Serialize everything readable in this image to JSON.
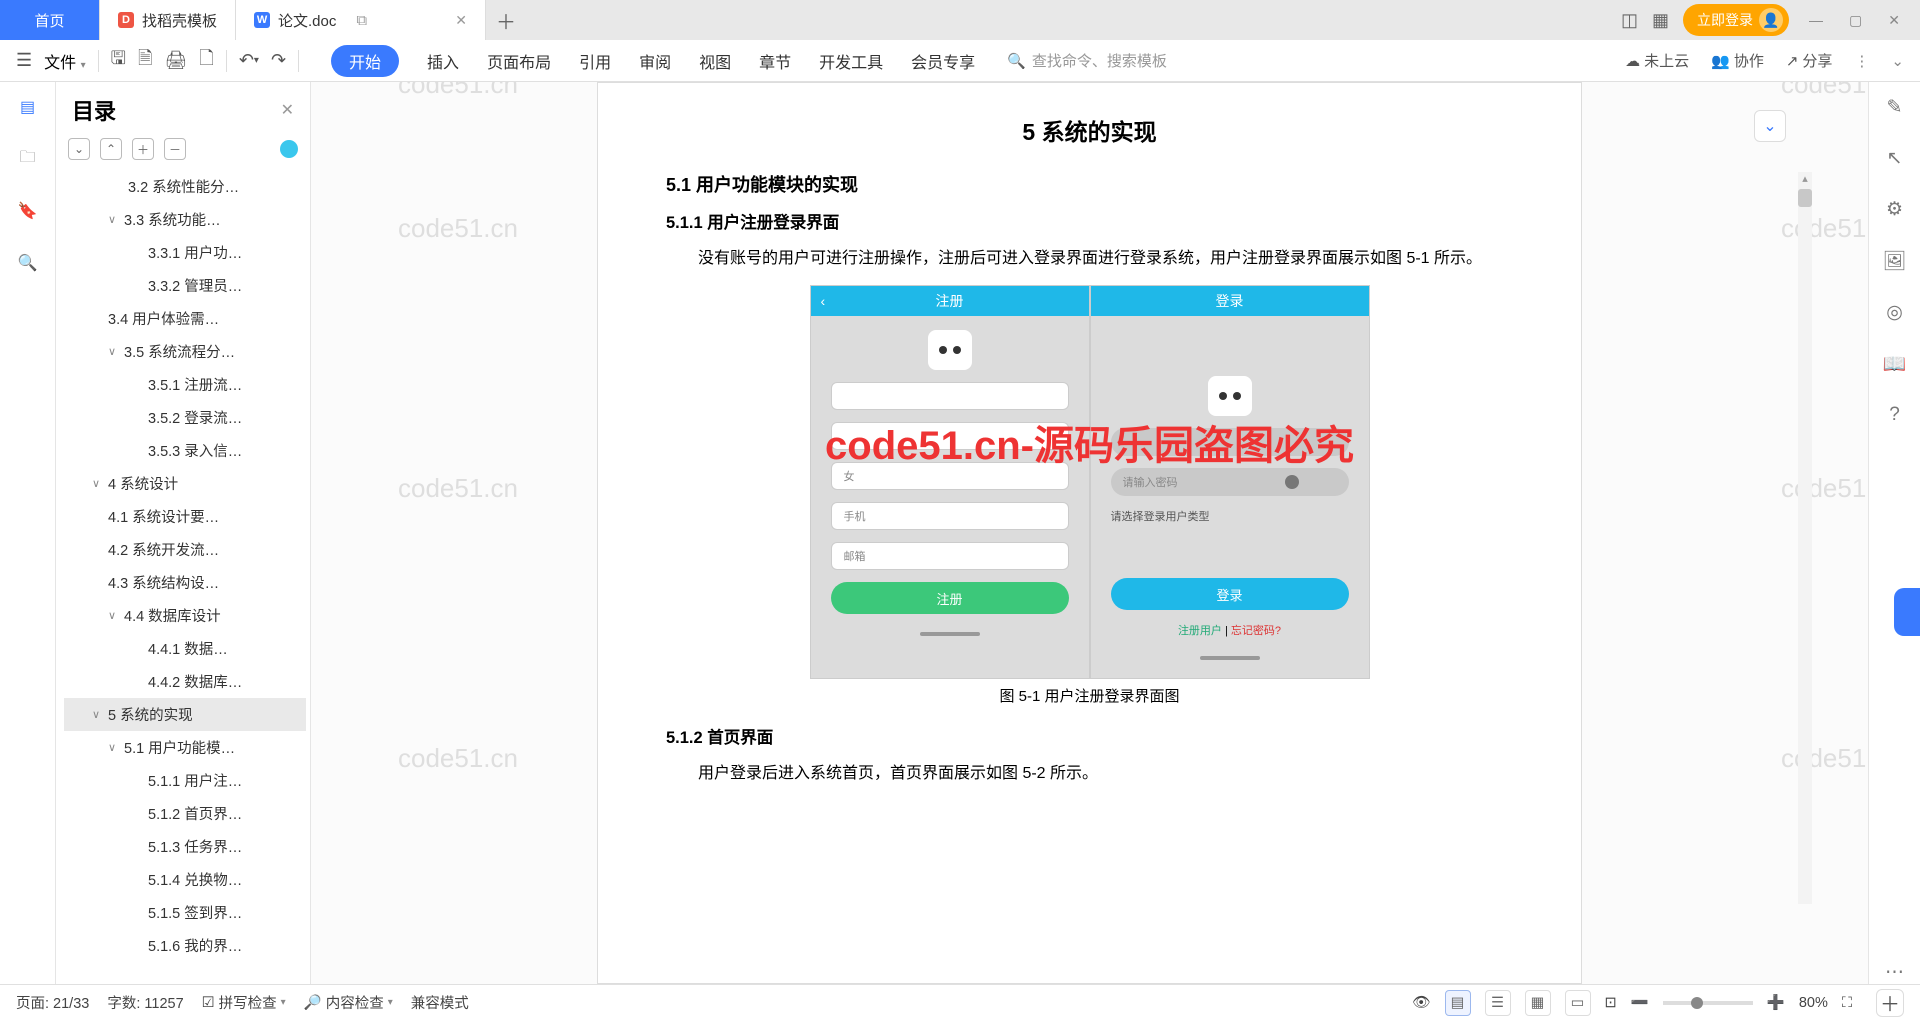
{
  "tabs": {
    "home": "首页",
    "template": "找稻壳模板",
    "doc": "论文.doc"
  },
  "title_right": {
    "login": "立即登录"
  },
  "file_menu": "文件",
  "menu": {
    "start": "开始",
    "insert": "插入",
    "pageLayout": "页面布局",
    "reference": "引用",
    "review": "审阅",
    "view": "视图",
    "section": "章节",
    "devTools": "开发工具",
    "member": "会员专享"
  },
  "search_placeholder": "查找命令、搜索模板",
  "toolbar_right": {
    "cloud": "未上云",
    "collab": "协作",
    "share": "分享"
  },
  "outline": {
    "title": "目录",
    "items": [
      {
        "t": "3.2 系统性能分…",
        "ind": 3,
        "chev": ""
      },
      {
        "t": "3.3  系统功能…",
        "ind": 2,
        "chev": "∨"
      },
      {
        "t": "3.3.1 用户功…",
        "ind": 4,
        "chev": ""
      },
      {
        "t": "3.3.2 管理员…",
        "ind": 4,
        "chev": ""
      },
      {
        "t": "3.4 用户体验需…",
        "ind": 2,
        "chev": ""
      },
      {
        "t": "3.5 系统流程分…",
        "ind": 2,
        "chev": "∨"
      },
      {
        "t": "3.5.1 注册流…",
        "ind": 4,
        "chev": ""
      },
      {
        "t": "3.5.2 登录流…",
        "ind": 4,
        "chev": ""
      },
      {
        "t": "3.5.3 录入信…",
        "ind": 4,
        "chev": ""
      },
      {
        "t": "4 系统设计",
        "ind": 1,
        "chev": "∨"
      },
      {
        "t": "4.1 系统设计要…",
        "ind": 2,
        "chev": ""
      },
      {
        "t": "4.2 系统开发流…",
        "ind": 2,
        "chev": ""
      },
      {
        "t": "4.3 系统结构设…",
        "ind": 2,
        "chev": ""
      },
      {
        "t": "4.4 数据库设计",
        "ind": 2,
        "chev": "∨"
      },
      {
        "t": "4.4.1 数据…",
        "ind": 4,
        "chev": ""
      },
      {
        "t": "4.4.2 数据库…",
        "ind": 4,
        "chev": ""
      },
      {
        "t": "5  系统的实现",
        "ind": 1,
        "chev": "∨",
        "sel": true
      },
      {
        "t": "5.1 用户功能模…",
        "ind": 2,
        "chev": "∨"
      },
      {
        "t": "5.1.1 用户注…",
        "ind": 4,
        "chev": ""
      },
      {
        "t": "5.1.2 首页界…",
        "ind": 4,
        "chev": ""
      },
      {
        "t": "5.1.3 任务界…",
        "ind": 4,
        "chev": ""
      },
      {
        "t": "5.1.4 兑换物…",
        "ind": 4,
        "chev": ""
      },
      {
        "t": "5.1.5 签到界…",
        "ind": 4,
        "chev": ""
      },
      {
        "t": "5.1.6 我的界…",
        "ind": 4,
        "chev": ""
      }
    ]
  },
  "doc": {
    "h1": "5  系统的实现",
    "h2_1": "5.1 用户功能模块的实现",
    "h3_1": "5.1.1 用户注册登录界面",
    "p1": "没有账号的用户可进行注册操作，注册后可进入登录界面进行登录系统，用户注册登录界面展示如图 5-1 所示。",
    "caption1": "图 5-1    用户注册登录界面图",
    "h3_2": "5.1.2 首页界面",
    "p2": "用户登录后进入系统首页，首页界面展示如图 5-2 所示。"
  },
  "phone_reg": {
    "title": "注册",
    "f1": "",
    "f2": "",
    "f3": "女",
    "f4": "手机",
    "f5": "邮箱",
    "btn": "注册"
  },
  "phone_login": {
    "title": "登录",
    "f1": "",
    "f2": "请输入密码",
    "tip": "请选择登录用户类型",
    "btn": "登录",
    "link1": "注册用户",
    "link2": "忘记密码?"
  },
  "watermarks": {
    "wm": "code51.cn",
    "red": "code51.cn-源码乐园盗图必究"
  },
  "status": {
    "page": "页面: 21/33",
    "words": "字数: 11257",
    "spell": "拼写检查",
    "content": "内容检查",
    "compat": "兼容模式",
    "zoom": "80%"
  }
}
